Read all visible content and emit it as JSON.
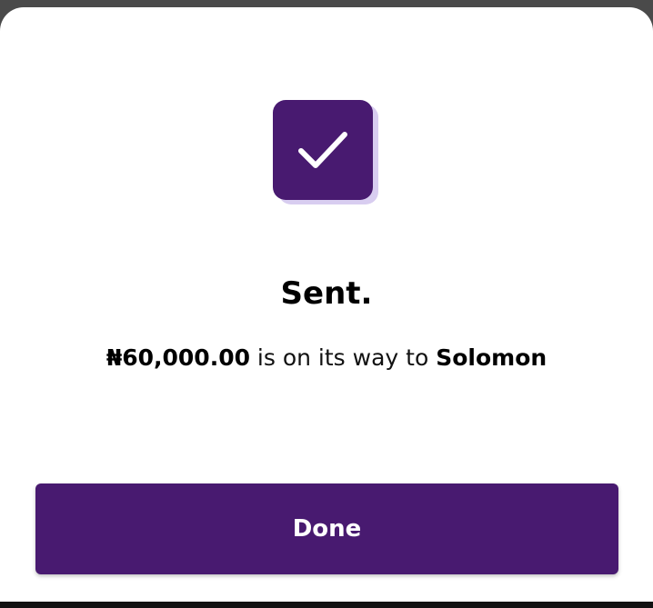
{
  "colors": {
    "brand_purple": "#481a70",
    "badge_shadow": "#d8cdf0",
    "background": "#ffffff"
  },
  "success_icon": {
    "name": "checkmark-icon"
  },
  "confirmation": {
    "title": "Sent.",
    "amount": "₦60,000.00",
    "middle_text": " is on its way to ",
    "recipient": "Solomon"
  },
  "actions": {
    "done_label": "Done"
  }
}
